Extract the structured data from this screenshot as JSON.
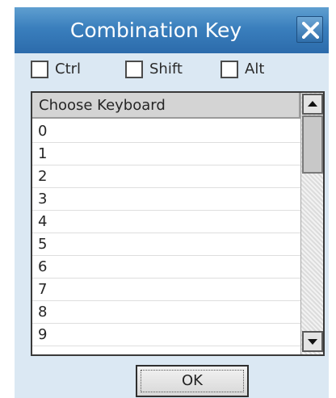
{
  "dialog": {
    "title": "Combination Key",
    "close_icon": "close-icon"
  },
  "modifiers": [
    {
      "label": "Ctrl",
      "checked": false
    },
    {
      "label": "Shift",
      "checked": false
    },
    {
      "label": "Alt",
      "checked": false
    }
  ],
  "keyboard_list": {
    "header": "Choose Keyboard",
    "items": [
      "0",
      "1",
      "2",
      "3",
      "4",
      "5",
      "6",
      "7",
      "8",
      "9"
    ]
  },
  "buttons": {
    "ok_label": "OK"
  },
  "colors": {
    "title_bar": "#3a7fbd",
    "dialog_bg": "#dbe8f3",
    "header_bg": "#d4d4d4"
  }
}
